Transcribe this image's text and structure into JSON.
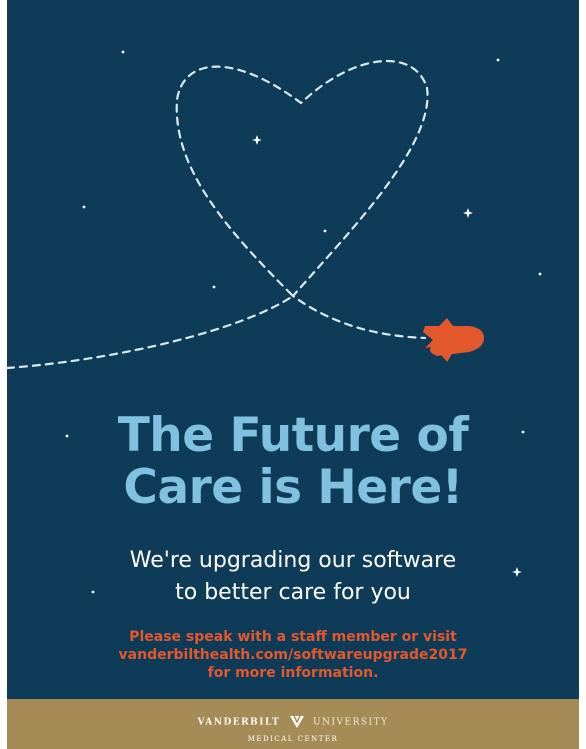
{
  "poster": {
    "headline": [
      "The Future of",
      "Care is Here!"
    ],
    "subheadline": [
      "We're upgrading our software",
      "to better care for you"
    ],
    "info": [
      "Please speak with a staff member or visit",
      "vanderbilthealth.com/softwareupgrade2017",
      "for more information."
    ]
  },
  "footer": {
    "logo_word_1": "VANDERBILT",
    "logo_word_2": "UNIVERSITY",
    "logo_sub": "MEDICAL CENTER"
  },
  "icons": [
    "dashed-heart-trail",
    "rocket-icon",
    "star-icon",
    "vu-logo-icon"
  ],
  "colors": {
    "background": "#0e3b57",
    "headline": "#7fc1de",
    "subheadline": "#ffffff",
    "info": "#e4582e",
    "rocket": "#e4582e",
    "footer": "#a58c56"
  }
}
